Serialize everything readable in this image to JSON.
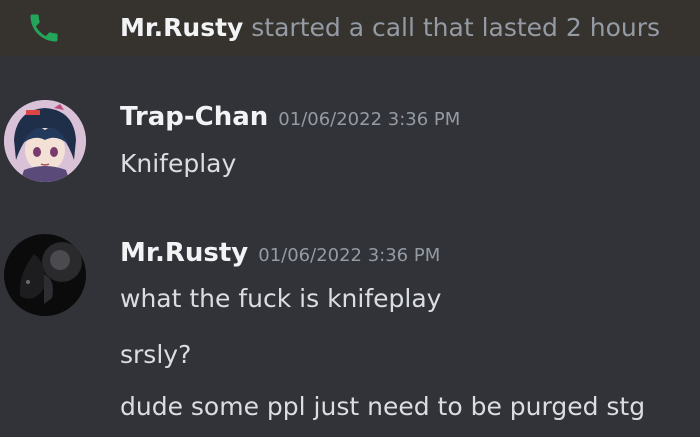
{
  "call": {
    "icon": "phone-icon",
    "icon_color": "#23a55a",
    "username": "Mr.Rusty",
    "text": " started a call that lasted 2 hours"
  },
  "messages": [
    {
      "username": "Trap-Chan",
      "timestamp": "01/06/2022 3:36 PM",
      "avatar": "anime-character-avatar",
      "lines": [
        "Knifeplay"
      ]
    },
    {
      "username": "Mr.Rusty",
      "timestamp": "01/06/2022 3:36 PM",
      "avatar": "dark-avatar",
      "lines": [
        "what the fuck is knifeplay",
        "srsly?",
        "dude some ppl just need to be purged stg"
      ]
    }
  ],
  "colors": {
    "background": "#313338",
    "call_bar": "#36332e",
    "username": "#f2f3f5",
    "muted": "#949ba4",
    "text": "#dbdee1"
  }
}
